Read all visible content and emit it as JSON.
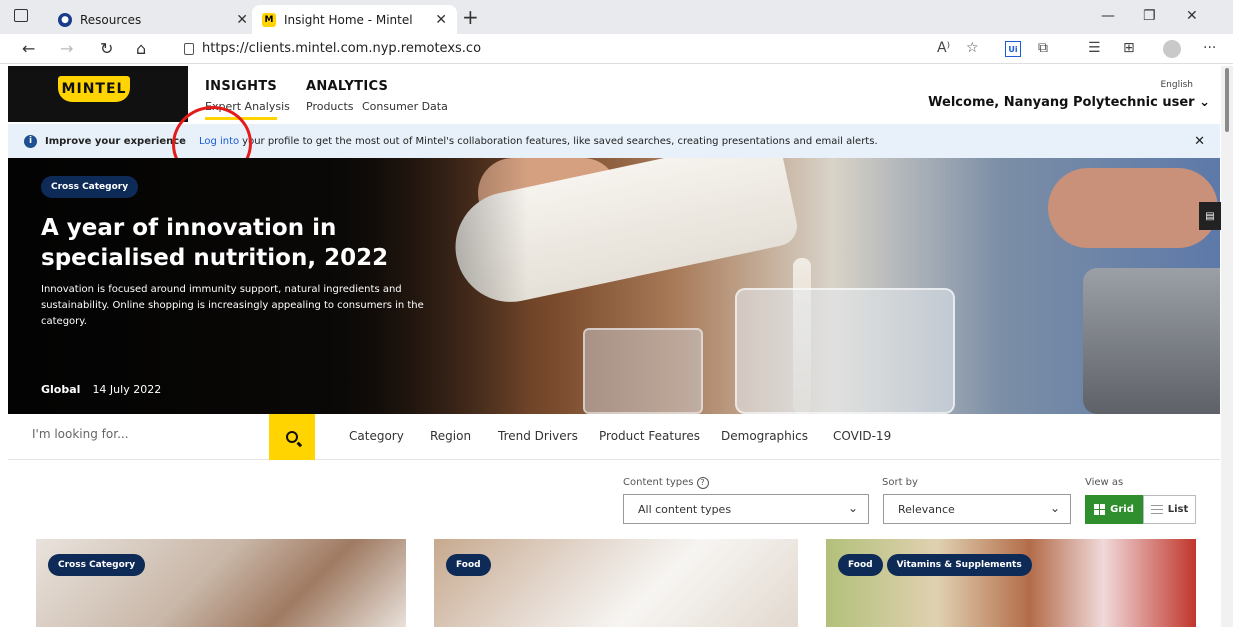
{
  "browser": {
    "tabs": [
      {
        "title": "Resources",
        "active": false
      },
      {
        "title": "Insight Home - Mintel",
        "active": true
      }
    ],
    "url": "https://clients.mintel.com.nyp.remotexs.co",
    "ui_ext_label": "Ui"
  },
  "header": {
    "logo": "MINTEL",
    "insights": {
      "title": "INSIGHTS",
      "links": [
        "Expert Analysis"
      ]
    },
    "analytics": {
      "title": "ANALYTICS",
      "links": [
        "Products",
        "Consumer Data"
      ]
    },
    "language": "English",
    "welcome": "Welcome, Nanyang Polytechnic user"
  },
  "banner": {
    "lead": "Improve your experience",
    "login_link": "Log into",
    "text": "your profile to get the most out of Mintel's collaboration features, like saved searches, creating presentations and email alerts."
  },
  "hero": {
    "badge": "Cross Category",
    "title": "A year of innovation in specialised nutrition, 2022",
    "description": "Innovation is focused around immunity support, natural ingredients and sustainability. Online shopping is increasingly appealing to consumers in the category.",
    "region": "Global",
    "date": "14 July 2022"
  },
  "search": {
    "placeholder": "I'm looking for...",
    "filters": [
      "Category",
      "Region",
      "Trend Drivers",
      "Product Features",
      "Demographics",
      "COVID-19"
    ]
  },
  "controls": {
    "content_types": {
      "label": "Content types",
      "value": "All content types"
    },
    "sort_by": {
      "label": "Sort by",
      "value": "Relevance"
    },
    "view_as": {
      "label": "View as",
      "grid": "Grid",
      "list": "List",
      "selected": "Grid"
    }
  },
  "cards": [
    {
      "badges": [
        "Cross Category"
      ]
    },
    {
      "badges": [
        "Food"
      ]
    },
    {
      "badges": [
        "Food",
        "Vitamins & Supplements"
      ]
    }
  ],
  "colors": {
    "brand_yellow": "#ffd400",
    "badge_navy": "#0e2b58",
    "grid_green": "#2f8f2f",
    "link_blue": "#1a5cd8",
    "annotation_red": "#e31b1b"
  }
}
